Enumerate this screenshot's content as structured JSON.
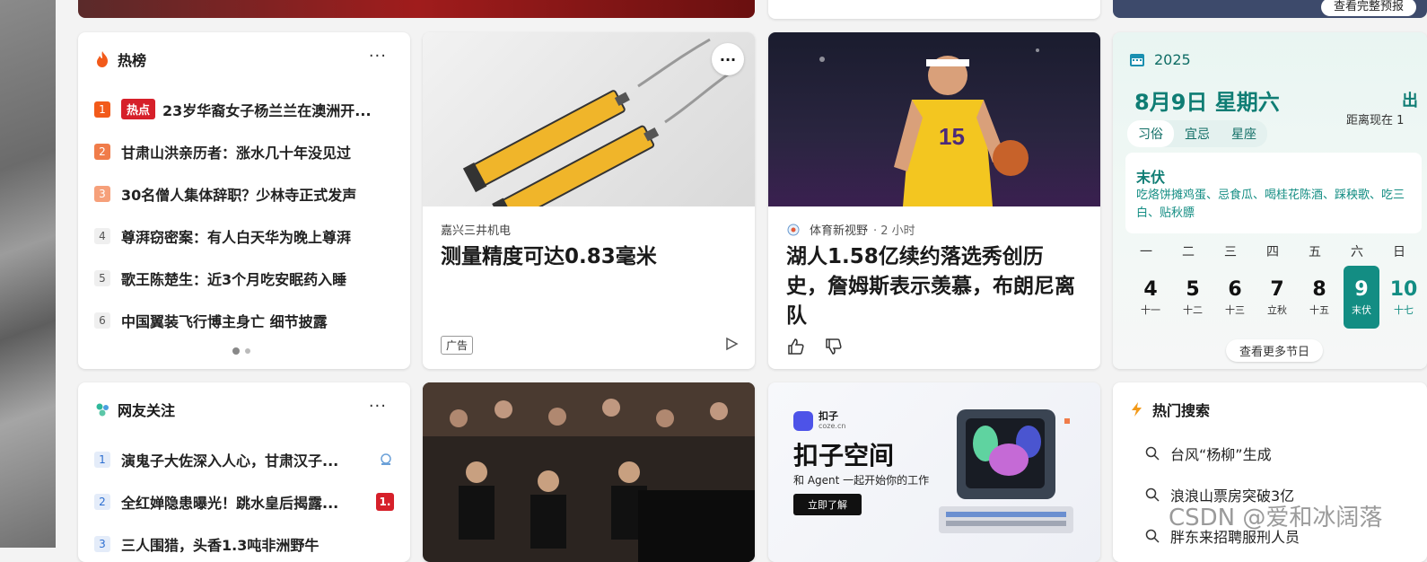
{
  "top_row": {
    "right_button": "查看完整预报"
  },
  "hot_list": {
    "title": "热榜",
    "more": "···",
    "hot_tag": "热点",
    "items": [
      {
        "rank": "1",
        "text": "23岁华裔女子杨兰兰在澳洲开..."
      },
      {
        "rank": "2",
        "text": "甘肃山洪亲历者：涨水几十年没见过"
      },
      {
        "rank": "3",
        "text": "30名僧人集体辞职？少林寺正式发声"
      },
      {
        "rank": "4",
        "text": "尊湃窃密案：有人白天华为晚上尊湃"
      },
      {
        "rank": "5",
        "text": "歌王陈楚生：近3个月吃安眠药入睡"
      },
      {
        "rank": "6",
        "text": "中国翼装飞行博主身亡 细节披露"
      }
    ]
  },
  "ad_card": {
    "source": "嘉兴三井机电",
    "headline": "测量精度可达0.83毫米",
    "ad_label": "广告",
    "more": "···"
  },
  "news_card": {
    "source": "体育新视野",
    "time": "· 2 小时",
    "headline": "湖人1.58亿续约落选秀创历史，詹姆斯表示羡慕，布朗尼离队"
  },
  "calendar": {
    "year": "2025",
    "date": "8月9日 星期六",
    "right_top": "出",
    "right_sub": "距离现在 1",
    "tabs": [
      "习俗",
      "宜忌",
      "星座"
    ],
    "festival": "末伏",
    "customs": "吃烙饼摊鸡蛋、忌食瓜、喝桂花陈酒、踩秧歌、吃三白、贴秋膘",
    "weekdays": [
      "一",
      "二",
      "三",
      "四",
      "五",
      "六",
      "日"
    ],
    "days": [
      {
        "n": "4",
        "l": "十一"
      },
      {
        "n": "5",
        "l": "十二"
      },
      {
        "n": "6",
        "l": "十三"
      },
      {
        "n": "7",
        "l": "立秋"
      },
      {
        "n": "8",
        "l": "十五"
      },
      {
        "n": "9",
        "l": "末伏"
      },
      {
        "n": "10",
        "l": "十七"
      }
    ],
    "more_button": "查看更多节日"
  },
  "friends_card": {
    "title": "网友关注",
    "more": "···",
    "items": [
      {
        "rank": "1",
        "text": "演鬼子大佐深入人心，甘肃汉子..."
      },
      {
        "rank": "2",
        "text": "全红婵隐患曝光！跳水皇后揭露..."
      },
      {
        "rank": "3",
        "text": "三人围猎，头香1.3吨非洲野牛"
      }
    ],
    "badge": "1."
  },
  "coze_card": {
    "brand": "扣子",
    "brand_sub": "coze.cn",
    "title": "扣子空间",
    "subtitle": "和 Agent 一起开始你的工作",
    "cta": "立即了解"
  },
  "hot_search": {
    "title": "热门搜索",
    "items": [
      "台风“杨柳”生成",
      "浪浪山票房突破3亿",
      "胖东来招聘服刑人员"
    ]
  },
  "watermark": "CSDN @爱和冰阔落",
  "colors": {
    "hot_red": "#d6202a",
    "rank1": "#f25a1a",
    "rank2": "#f07c4a",
    "rank3": "#f6a07a",
    "calendar_teal": "#138d83"
  }
}
